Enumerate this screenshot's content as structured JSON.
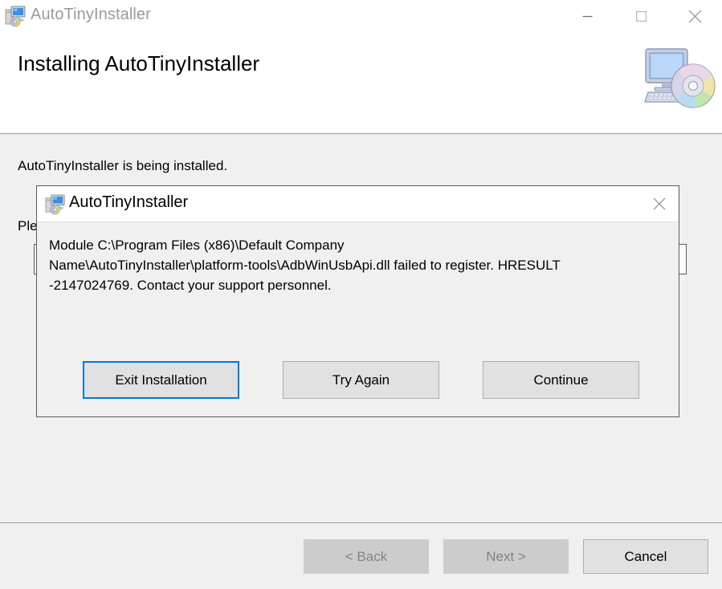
{
  "window": {
    "title": "AutoTinyInstaller",
    "icon": "installer-computer-disc-icon",
    "controls": {
      "minimize": "minimize-icon",
      "maximize": "maximize-icon",
      "close": "close-icon"
    }
  },
  "header": {
    "title": "Installing AutoTinyInstaller",
    "icon": "computer-cd-graphic"
  },
  "main": {
    "status": "AutoTinyInstaller is being installed.",
    "wait_text": "Please wait",
    "progress": {
      "percent": 3
    }
  },
  "dialog": {
    "title": "AutoTinyInstaller",
    "icon": "installer-computer-disc-icon",
    "close_icon": "close-icon",
    "message": "Module C:\\Program Files (x86)\\Default Company\nName\\AutoTinyInstaller\\platform-tools\\AdbWinUsbApi.dll failed to register.  HRESULT\n-2147024769.  Contact your support personnel.",
    "buttons": {
      "exit": "Exit Installation",
      "try_again": "Try Again",
      "continue": "Continue"
    },
    "focused_button": "Exit Installation"
  },
  "footer": {
    "back": "< Back",
    "next": "Next >",
    "cancel": "Cancel",
    "back_enabled": false,
    "next_enabled": false,
    "cancel_enabled": true
  },
  "colors": {
    "accent": "#0078d7",
    "dialog_bg": "#f0f0f0",
    "button_face": "#e1e1e1",
    "disabled_face": "#cccccc",
    "progress_fill": "#a8c0dd",
    "title_text": "#9a9a9a"
  }
}
